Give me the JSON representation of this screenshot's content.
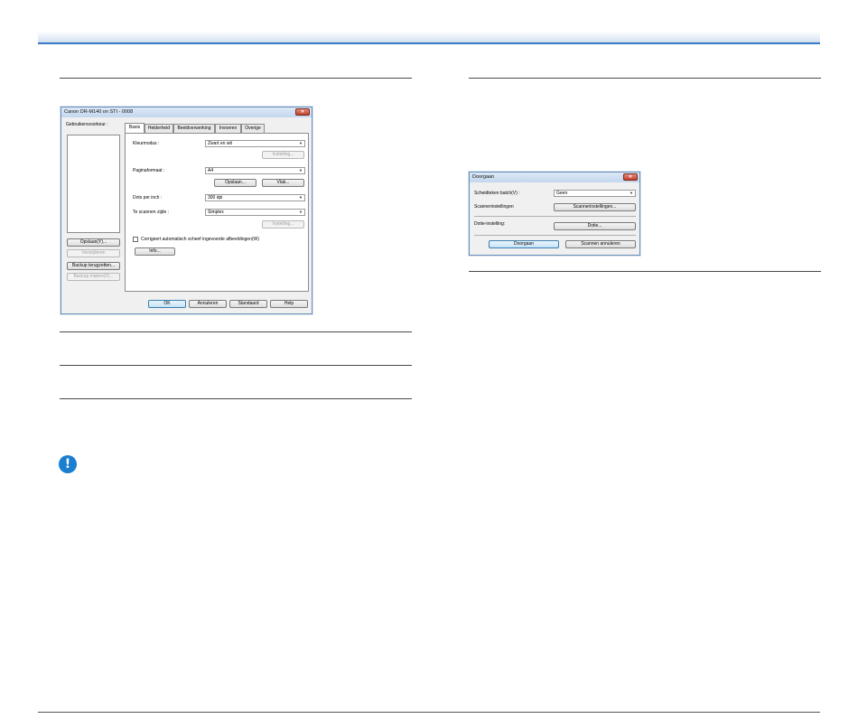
{
  "dialog_main": {
    "title": "Canon DR-M140 on STI - 0008",
    "close_glyph": "✕",
    "user_prefs_label": "Gebruikersvoorkeur :",
    "left_buttons": {
      "save": "Opslaan(Y)...",
      "remove": "Verwijderen",
      "backup_restore": "Backup terugzetten...",
      "backup_make": "Backup maken(X)..."
    },
    "tabs": [
      "Basis",
      "Helderheid",
      "Beeldverwerking",
      "Invoeren",
      "Overige"
    ],
    "color_mode": {
      "label": "Kleurmodus :",
      "value": "Zwart en wit",
      "settings_button": "Instelling..."
    },
    "page_size": {
      "label": "Paginaformaat :",
      "value": "A4",
      "save_button": "Opslaan...",
      "area_button": "Vlak..."
    },
    "dpi": {
      "label": "Dots per inch :",
      "value": "300 dpi"
    },
    "scan_side": {
      "label": "Te scannen zijde :",
      "value": "Simplex",
      "settings_button": "Instelling..."
    },
    "deskew_checkbox": "Corrigeert automatisch scheef ingevoerde afbeeldingen(W)",
    "info_button": "Info...",
    "footer": {
      "ok": "OK",
      "cancel": "Annuleren",
      "default": "Standaard",
      "help": "Help"
    }
  },
  "dialog_continue": {
    "title": "Doorgaan",
    "close_glyph": "✕",
    "separator_label": "Scheidteken batch(V) :",
    "separator_value": "Geen",
    "scanner_settings_label": "Scannerinstellingen",
    "scanner_settings_button": "Scannerinstellingen...",
    "dotie_label": "Dotie-instelling:",
    "dotie_button": "Dotie...",
    "continue_button": "Doorgaan",
    "cancel_scan_button": "Scannen annuleren"
  },
  "icons": {
    "combo_arrow": "▼",
    "warning_glyph": "!"
  },
  "colors": {
    "accent": "#3a7cc4",
    "warning": "#1a7fd0"
  }
}
